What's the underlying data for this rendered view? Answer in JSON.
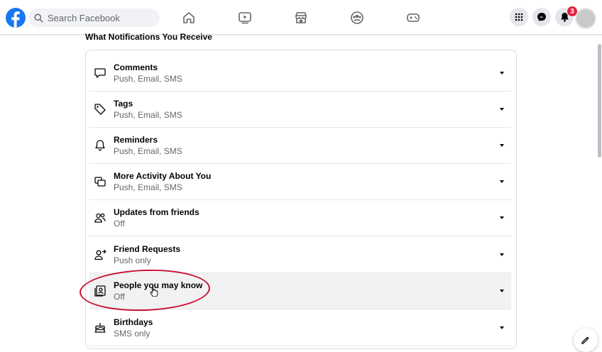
{
  "header": {
    "search": {
      "placeholder": "Search Facebook"
    },
    "notification_count": "3",
    "nav": [
      "home-icon",
      "watch-icon",
      "marketplace-icon",
      "groups-icon",
      "gaming-icon"
    ],
    "right_buttons": [
      "menu-grid-icon",
      "messenger-icon",
      "bell-icon"
    ]
  },
  "page": {
    "section_title": "What Notifications You Receive",
    "items": [
      {
        "title": "Comments",
        "sub": "Push, Email, SMS",
        "icon": "comment-icon"
      },
      {
        "title": "Tags",
        "sub": "Push, Email, SMS",
        "icon": "tag-icon"
      },
      {
        "title": "Reminders",
        "sub": "Push, Email, SMS",
        "icon": "bell-icon"
      },
      {
        "title": "More Activity About You",
        "sub": "Push, Email, SMS",
        "icon": "activity-icon"
      },
      {
        "title": "Updates from friends",
        "sub": "Off",
        "icon": "friends-icon"
      },
      {
        "title": "Friend Requests",
        "sub": "Push only",
        "icon": "friend-request-icon"
      },
      {
        "title": "People you may know",
        "sub": "Off",
        "icon": "contact-card-icon"
      },
      {
        "title": "Birthdays",
        "sub": "SMS only",
        "icon": "cake-icon"
      }
    ]
  },
  "colors": {
    "brand": "#1877f2",
    "badge": "#e41e3f",
    "annotation": "#c8102e"
  }
}
